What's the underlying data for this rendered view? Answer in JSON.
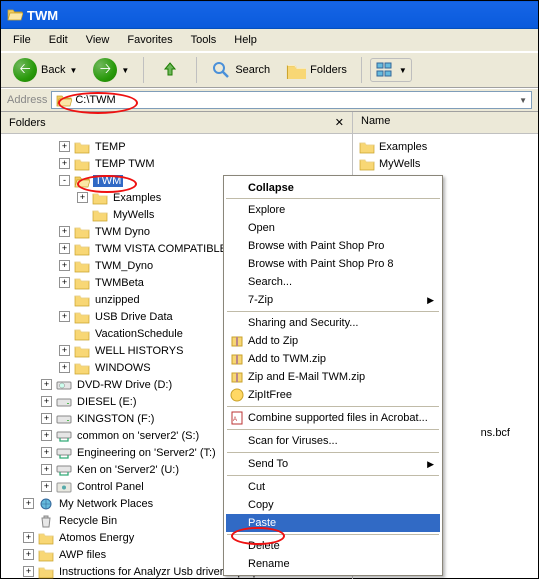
{
  "window": {
    "title": "TWM"
  },
  "menubar": [
    "File",
    "Edit",
    "View",
    "Favorites",
    "Tools",
    "Help"
  ],
  "toolbar": {
    "back": "Back",
    "search": "Search",
    "folders": "Folders"
  },
  "address": {
    "label": "Address",
    "value": "C:\\TWM"
  },
  "folders_pane": {
    "title": "Folders"
  },
  "right_header": "Name",
  "right_items": [
    "Examples",
    "MyWells"
  ],
  "tree": [
    {
      "ind": 1,
      "exp": "+",
      "icon": "folder",
      "label": "TEMP"
    },
    {
      "ind": 1,
      "exp": "+",
      "icon": "folder",
      "label": "TEMP TWM"
    },
    {
      "ind": 1,
      "exp": "-",
      "icon": "folder-open",
      "label": "TWM",
      "selected": true,
      "annot": true
    },
    {
      "ind": 2,
      "exp": "+",
      "icon": "folder",
      "label": "Examples"
    },
    {
      "ind": 2,
      "exp": "",
      "icon": "folder",
      "label": "MyWells"
    },
    {
      "ind": 1,
      "exp": "+",
      "icon": "folder",
      "label": "TWM Dyno"
    },
    {
      "ind": 1,
      "exp": "+",
      "icon": "folder",
      "label": "TWM VISTA COMPATIBLE INSTALLER"
    },
    {
      "ind": 1,
      "exp": "+",
      "icon": "folder",
      "label": "TWM_Dyno"
    },
    {
      "ind": 1,
      "exp": "+",
      "icon": "folder",
      "label": "TWMBeta"
    },
    {
      "ind": 1,
      "exp": "",
      "icon": "folder",
      "label": "unzipped"
    },
    {
      "ind": 1,
      "exp": "+",
      "icon": "folder",
      "label": "USB Drive Data"
    },
    {
      "ind": 1,
      "exp": "",
      "icon": "folder",
      "label": "VacationSchedule"
    },
    {
      "ind": 1,
      "exp": "+",
      "icon": "folder",
      "label": "WELL HISTORYS"
    },
    {
      "ind": 1,
      "exp": "+",
      "icon": "folder",
      "label": "WINDOWS"
    },
    {
      "ind": 0,
      "exp": "+",
      "icon": "drive-cd",
      "label": "DVD-RW Drive (D:)"
    },
    {
      "ind": 0,
      "exp": "+",
      "icon": "drive",
      "label": "DIESEL (E:)"
    },
    {
      "ind": 0,
      "exp": "+",
      "icon": "drive",
      "label": "KINGSTON (F:)"
    },
    {
      "ind": 0,
      "exp": "+",
      "icon": "drive-net",
      "label": "common on 'server2' (S:)"
    },
    {
      "ind": 0,
      "exp": "+",
      "icon": "drive-net",
      "label": "Engineering on 'Server2' (T:)"
    },
    {
      "ind": 0,
      "exp": "+",
      "icon": "drive-net",
      "label": "Ken on 'Server2' (U:)"
    },
    {
      "ind": 0,
      "exp": "+",
      "icon": "control",
      "label": "Control Panel"
    },
    {
      "ind": -1,
      "exp": "+",
      "icon": "netplaces",
      "label": "My Network Places"
    },
    {
      "ind": -1,
      "exp": "",
      "icon": "recycle",
      "label": "Recycle Bin"
    },
    {
      "ind": -1,
      "exp": "+",
      "icon": "folder",
      "label": "Atomos Energy"
    },
    {
      "ind": -1,
      "exp": "+",
      "icon": "folder",
      "label": "AWP files"
    },
    {
      "ind": -1,
      "exp": "+",
      "icon": "folder",
      "label": "Instructions for Analyzr Usb driverslaptop"
    }
  ],
  "right_extra": "ns.bcf",
  "ctx": {
    "head": "Collapse",
    "items": [
      {
        "t": "Explore"
      },
      {
        "t": "Open"
      },
      {
        "t": "Browse with Paint Shop Pro"
      },
      {
        "t": "Browse with Paint Shop Pro 8"
      },
      {
        "t": "Search..."
      },
      {
        "t": "7-Zip",
        "sub": true
      },
      "sep",
      {
        "t": "Sharing and Security..."
      },
      {
        "t": "Add to Zip",
        "i": "zip"
      },
      {
        "t": "Add to TWM.zip",
        "i": "zip"
      },
      {
        "t": "Zip and E-Mail TWM.zip",
        "i": "zip"
      },
      {
        "t": "ZipItFree",
        "i": "zipfree"
      },
      "sep",
      {
        "t": "Combine supported files in Acrobat...",
        "i": "pdf"
      },
      "sep",
      {
        "t": "Scan for Viruses..."
      },
      "sep",
      {
        "t": "Send To",
        "sub": true
      },
      "sep",
      {
        "t": "Cut"
      },
      {
        "t": "Copy"
      },
      {
        "t": "Paste",
        "hl": true,
        "annot": true
      },
      "sep",
      {
        "t": "Delete"
      },
      {
        "t": "Rename"
      }
    ]
  }
}
